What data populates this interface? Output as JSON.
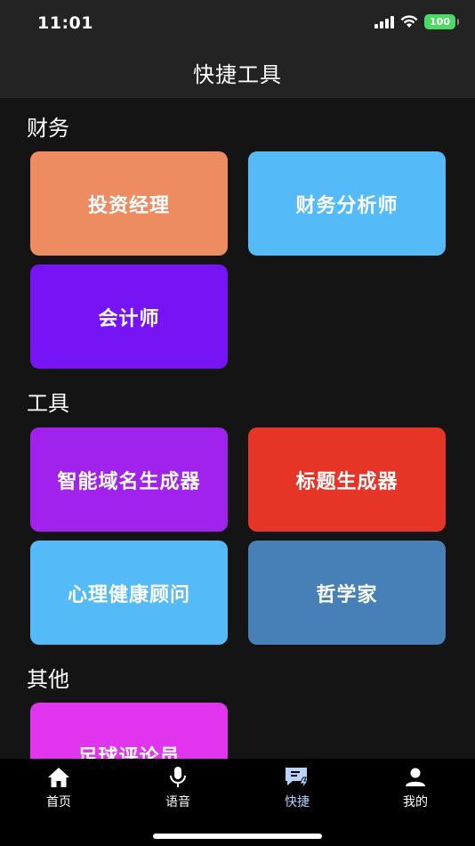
{
  "status_bar": {
    "time": "11:01",
    "battery": "100"
  },
  "header": {
    "title": "快捷工具"
  },
  "sections": [
    {
      "title": "财务",
      "items": [
        {
          "label": "投资经理",
          "color": "#ed8b61"
        },
        {
          "label": "财务分析师",
          "color": "#55bbf8"
        },
        {
          "label": "会计师",
          "color": "#7714f5"
        }
      ]
    },
    {
      "title": "工具",
      "items": [
        {
          "label": "智能域名生成器",
          "color": "#a122ec"
        },
        {
          "label": "标题生成器",
          "color": "#e63427"
        },
        {
          "label": "心理健康顾问",
          "color": "#55bbf8"
        },
        {
          "label": "哲学家",
          "color": "#4780b6"
        }
      ]
    },
    {
      "title": "其他",
      "items": [
        {
          "label": "足球评论员",
          "color": "#e134ee"
        }
      ]
    }
  ],
  "tabbar": {
    "items": [
      {
        "label": "首页",
        "icon": "home-icon"
      },
      {
        "label": "语音",
        "icon": "microphone-icon"
      },
      {
        "label": "快捷",
        "icon": "chat-bolt-icon",
        "active": true,
        "active_color": "#b9d3ff"
      },
      {
        "label": "我的",
        "icon": "person-icon"
      }
    ]
  }
}
